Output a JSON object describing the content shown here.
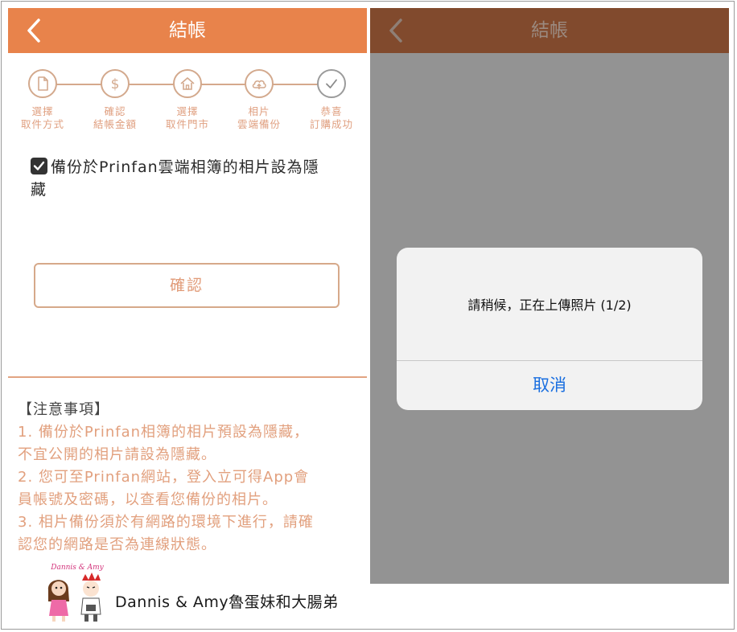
{
  "left": {
    "header": {
      "title": "結帳"
    },
    "steps": [
      {
        "icon": "document-icon",
        "label_line1": "選擇",
        "label_line2": "取件方式"
      },
      {
        "icon": "dollar-icon",
        "label_line1": "確認",
        "label_line2": "結帳金額"
      },
      {
        "icon": "store-icon",
        "label_line1": "選擇",
        "label_line2": "取件門市"
      },
      {
        "icon": "cloud-upload-icon",
        "label_line1": "相片",
        "label_line2": "雲端備份"
      },
      {
        "icon": "check-icon",
        "label_line1": "恭喜",
        "label_line2": "訂購成功"
      }
    ],
    "checkbox": {
      "checked": true,
      "line1": "備份於Prinfan雲端相簿的相片設為隱",
      "line2": "藏"
    },
    "confirm_label": "確認",
    "notes": {
      "heading": "【注意事項】",
      "lines": [
        "1. 備份於Prinfan相簿的相片預設為隱藏，",
        "不宜公開的相片請設為隱藏。",
        "2. 您可至Prinfan網站，登入立可得App會",
        "員帳號及密碼，以查看您備份的相片。",
        "3. 相片備份須於有網路的環境下進行，請確",
        "認您的網路是否為連線狀態。"
      ]
    }
  },
  "right": {
    "header": {
      "title": "結帳"
    },
    "dialog": {
      "message": "請稍候，正在上傳照片 (1/2)",
      "cancel_label": "取消"
    }
  },
  "watermark": {
    "logo_text": "Dannis & Amy",
    "text": "Dannis & Amy魯蛋妹和大腸弟"
  },
  "colors": {
    "accent": "#e8834b",
    "header_dimmed": "#814a2d",
    "overlay": "#939393",
    "link_blue": "#1a6fe0"
  }
}
